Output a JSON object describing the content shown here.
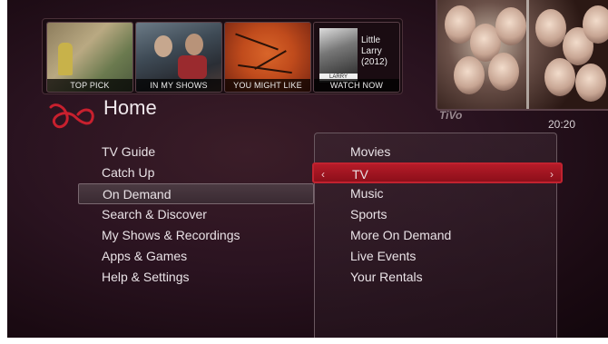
{
  "thumbnails": [
    {
      "caption": "TOP PICK"
    },
    {
      "caption": "IN MY SHOWS"
    },
    {
      "caption": "YOU MIGHT LIKE"
    },
    {
      "caption": "WATCH NOW",
      "title_lines": [
        "Little",
        "Larry",
        "(2012)"
      ],
      "poster_label": "LARRY"
    }
  ],
  "header": {
    "title": "Home",
    "brand_mark": "TiVo",
    "clock": "20:20"
  },
  "left_menu": {
    "items": [
      {
        "label": "TV Guide"
      },
      {
        "label": "Catch Up"
      },
      {
        "label": "On Demand",
        "selected": true
      },
      {
        "label": "Search & Discover"
      },
      {
        "label": "My Shows & Recordings"
      },
      {
        "label": "Apps & Games"
      },
      {
        "label": "Help & Settings"
      }
    ]
  },
  "right_menu": {
    "items": [
      {
        "label": "Movies"
      },
      {
        "label": "TV",
        "selected": true
      },
      {
        "label": "Music"
      },
      {
        "label": "Sports"
      },
      {
        "label": "More On Demand"
      },
      {
        "label": "Live Events"
      },
      {
        "label": "Your Rentals"
      }
    ],
    "arrow_left": "‹",
    "arrow_right": "›"
  },
  "colors": {
    "accent_red": "#b51b28",
    "background": "#2a1320"
  }
}
